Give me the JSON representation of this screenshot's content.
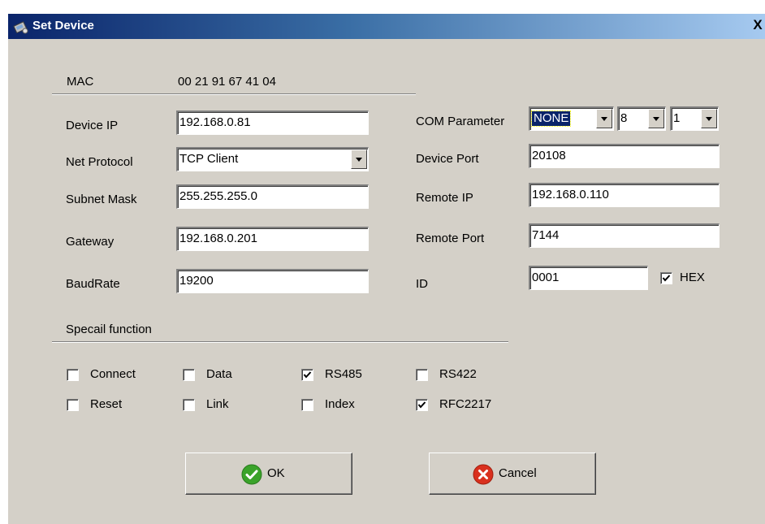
{
  "window": {
    "title": "Set Device",
    "close_label": "X"
  },
  "mac": {
    "label": "MAC",
    "value": "00 21 91 67 41 04"
  },
  "left_fields": {
    "device_ip": {
      "label": "Device IP",
      "value": "192.168.0.81"
    },
    "net_protocol": {
      "label": "Net Protocol",
      "value": "TCP Client"
    },
    "subnet_mask": {
      "label": "Subnet Mask",
      "value": "255.255.255.0"
    },
    "gateway": {
      "label": "Gateway",
      "value": "192.168.0.201"
    },
    "baudrate": {
      "label": "BaudRate",
      "value": "19200"
    }
  },
  "com_parameter": {
    "label": "COM Parameter",
    "parity": "NONE",
    "data_bits": "8",
    "stop_bits": "1"
  },
  "right_fields": {
    "device_port": {
      "label": "Device Port",
      "value": "20108"
    },
    "remote_ip": {
      "label": "Remote IP",
      "value": "192.168.0.110"
    },
    "remote_port": {
      "label": "Remote Port",
      "value": "7144"
    },
    "id": {
      "label": "ID",
      "value": "0001"
    }
  },
  "hex": {
    "label": "HEX",
    "checked": true
  },
  "special": {
    "title": "Specail function",
    "options": [
      {
        "label": "Connect",
        "checked": false
      },
      {
        "label": "Data",
        "checked": false
      },
      {
        "label": "RS485",
        "checked": true
      },
      {
        "label": "RS422",
        "checked": false
      },
      {
        "label": "Reset",
        "checked": false
      },
      {
        "label": "Link",
        "checked": false
      },
      {
        "label": "Index",
        "checked": false
      },
      {
        "label": "RFC2217",
        "checked": true
      }
    ]
  },
  "buttons": {
    "ok_label": "OK",
    "cancel_label": "Cancel"
  },
  "colors": {
    "titlebar_start": "#0a246a",
    "titlebar_end": "#a6caf0",
    "dialog_bg": "#d4d0c8",
    "ok_green": "#3aa32a",
    "cancel_red": "#d9301e"
  }
}
